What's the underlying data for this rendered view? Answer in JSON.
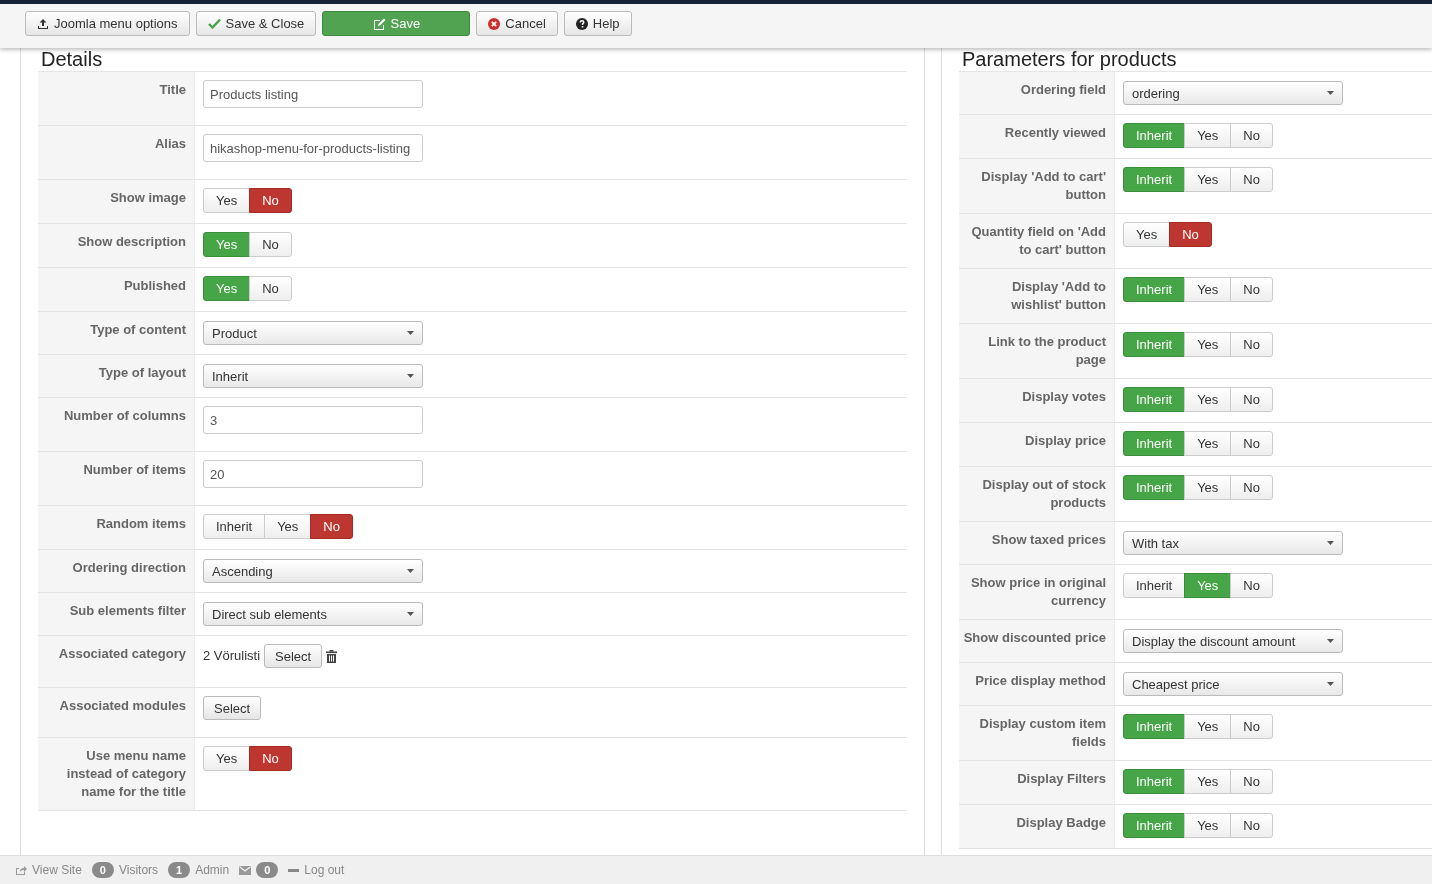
{
  "toolbar": {
    "buttons": [
      {
        "label": "Joomla menu options",
        "primary": false
      },
      {
        "label": "Save & Close",
        "primary": false
      },
      {
        "label": "Save",
        "primary": true
      },
      {
        "label": "Cancel",
        "primary": false
      },
      {
        "label": "Help",
        "primary": false
      }
    ]
  },
  "details": {
    "title": "Details",
    "rows": [
      {
        "kind": "text",
        "label": "Title",
        "value": "Products listing"
      },
      {
        "kind": "text",
        "label": "Alias",
        "value": "hikashop-menu-for-products-listing"
      },
      {
        "kind": "toggle",
        "label": "Show image",
        "options": [
          {
            "label": "Yes",
            "kind": "yes",
            "selected": false
          },
          {
            "label": "No",
            "kind": "no",
            "selected": true
          }
        ]
      },
      {
        "kind": "toggle",
        "label": "Show description",
        "options": [
          {
            "label": "Yes",
            "kind": "yes",
            "selected": true
          },
          {
            "label": "No",
            "kind": "no",
            "selected": false
          }
        ]
      },
      {
        "kind": "toggle",
        "label": "Published",
        "options": [
          {
            "label": "Yes",
            "kind": "yes",
            "selected": true
          },
          {
            "label": "No",
            "kind": "no",
            "selected": false
          }
        ]
      },
      {
        "kind": "select",
        "label": "Type of content",
        "value": "Product"
      },
      {
        "kind": "select",
        "label": "Type of layout",
        "value": "Inherit"
      },
      {
        "kind": "text",
        "label": "Number of columns",
        "value": "3"
      },
      {
        "kind": "text",
        "label": "Number of items",
        "value": "20"
      },
      {
        "kind": "toggle",
        "label": "Random items",
        "options": [
          {
            "label": "Inherit",
            "kind": "inherit",
            "selected": false
          },
          {
            "label": "Yes",
            "kind": "yes",
            "selected": false
          },
          {
            "label": "No",
            "kind": "no",
            "selected": true
          }
        ]
      },
      {
        "kind": "select",
        "label": "Ordering direction",
        "value": "Ascending"
      },
      {
        "kind": "select",
        "label": "Sub elements filter",
        "value": "Direct sub elements"
      },
      {
        "kind": "category",
        "label": "Associated category",
        "value": "2 Vörulisti",
        "button": "Select"
      },
      {
        "kind": "button",
        "label": "Associated modules",
        "button": "Select"
      },
      {
        "kind": "toggle",
        "label": "Use menu name instead of category name for the title",
        "options": [
          {
            "label": "Yes",
            "kind": "yes",
            "selected": false
          },
          {
            "label": "No",
            "kind": "no",
            "selected": true
          }
        ]
      }
    ]
  },
  "parameters": {
    "title": "Parameters for products",
    "rows": [
      {
        "kind": "select",
        "label": "Ordering field",
        "value": "ordering"
      },
      {
        "kind": "toggle",
        "label": "Recently viewed",
        "options": [
          {
            "label": "Inherit",
            "kind": "inherit",
            "selected": true
          },
          {
            "label": "Yes",
            "kind": "yes",
            "selected": false
          },
          {
            "label": "No",
            "kind": "no",
            "selected": false
          }
        ]
      },
      {
        "kind": "toggle",
        "label": "Display 'Add to cart' button",
        "options": [
          {
            "label": "Inherit",
            "kind": "inherit",
            "selected": true
          },
          {
            "label": "Yes",
            "kind": "yes",
            "selected": false
          },
          {
            "label": "No",
            "kind": "no",
            "selected": false
          }
        ]
      },
      {
        "kind": "toggle",
        "label": "Quantity field on 'Add to cart' button",
        "options": [
          {
            "label": "Yes",
            "kind": "yes",
            "selected": false
          },
          {
            "label": "No",
            "kind": "no",
            "selected": true
          }
        ]
      },
      {
        "kind": "toggle",
        "label": "Display 'Add to wishlist' button",
        "options": [
          {
            "label": "Inherit",
            "kind": "inherit",
            "selected": true
          },
          {
            "label": "Yes",
            "kind": "yes",
            "selected": false
          },
          {
            "label": "No",
            "kind": "no",
            "selected": false
          }
        ]
      },
      {
        "kind": "toggle",
        "label": "Link to the product page",
        "options": [
          {
            "label": "Inherit",
            "kind": "inherit",
            "selected": true
          },
          {
            "label": "Yes",
            "kind": "yes",
            "selected": false
          },
          {
            "label": "No",
            "kind": "no",
            "selected": false
          }
        ]
      },
      {
        "kind": "toggle",
        "label": "Display votes",
        "options": [
          {
            "label": "Inherit",
            "kind": "inherit",
            "selected": true
          },
          {
            "label": "Yes",
            "kind": "yes",
            "selected": false
          },
          {
            "label": "No",
            "kind": "no",
            "selected": false
          }
        ]
      },
      {
        "kind": "toggle",
        "label": "Display price",
        "options": [
          {
            "label": "Inherit",
            "kind": "inherit",
            "selected": true
          },
          {
            "label": "Yes",
            "kind": "yes",
            "selected": false
          },
          {
            "label": "No",
            "kind": "no",
            "selected": false
          }
        ]
      },
      {
        "kind": "toggle",
        "label": "Display out of stock products",
        "options": [
          {
            "label": "Inherit",
            "kind": "inherit",
            "selected": true
          },
          {
            "label": "Yes",
            "kind": "yes",
            "selected": false
          },
          {
            "label": "No",
            "kind": "no",
            "selected": false
          }
        ]
      },
      {
        "kind": "select",
        "label": "Show taxed prices",
        "value": "With tax"
      },
      {
        "kind": "toggle",
        "label": "Show price in original currency",
        "options": [
          {
            "label": "Inherit",
            "kind": "inherit",
            "selected": false
          },
          {
            "label": "Yes",
            "kind": "yes",
            "selected": true
          },
          {
            "label": "No",
            "kind": "no",
            "selected": false
          }
        ]
      },
      {
        "kind": "select",
        "label": "Show discounted price",
        "value": "Display the discount amount"
      },
      {
        "kind": "select",
        "label": "Price display method",
        "value": "Cheapest price"
      },
      {
        "kind": "toggle",
        "label": "Display custom item fields",
        "options": [
          {
            "label": "Inherit",
            "kind": "inherit",
            "selected": true
          },
          {
            "label": "Yes",
            "kind": "yes",
            "selected": false
          },
          {
            "label": "No",
            "kind": "no",
            "selected": false
          }
        ]
      },
      {
        "kind": "toggle",
        "label": "Display Filters",
        "options": [
          {
            "label": "Inherit",
            "kind": "inherit",
            "selected": true
          },
          {
            "label": "Yes",
            "kind": "yes",
            "selected": false
          },
          {
            "label": "No",
            "kind": "no",
            "selected": false
          }
        ]
      },
      {
        "kind": "toggle",
        "label": "Display Badge",
        "options": [
          {
            "label": "Inherit",
            "kind": "inherit",
            "selected": true
          },
          {
            "label": "Yes",
            "kind": "yes",
            "selected": false
          },
          {
            "label": "No",
            "kind": "no",
            "selected": false
          }
        ]
      }
    ]
  },
  "status_bar": {
    "items": [
      {
        "kind": "link",
        "label": "View Site"
      },
      {
        "kind": "count",
        "count": "0",
        "label": "Visitors"
      },
      {
        "kind": "count",
        "count": "1",
        "label": "Admin"
      },
      {
        "kind": "mail",
        "count": "0"
      },
      {
        "kind": "link",
        "label": "Log out"
      }
    ]
  }
}
